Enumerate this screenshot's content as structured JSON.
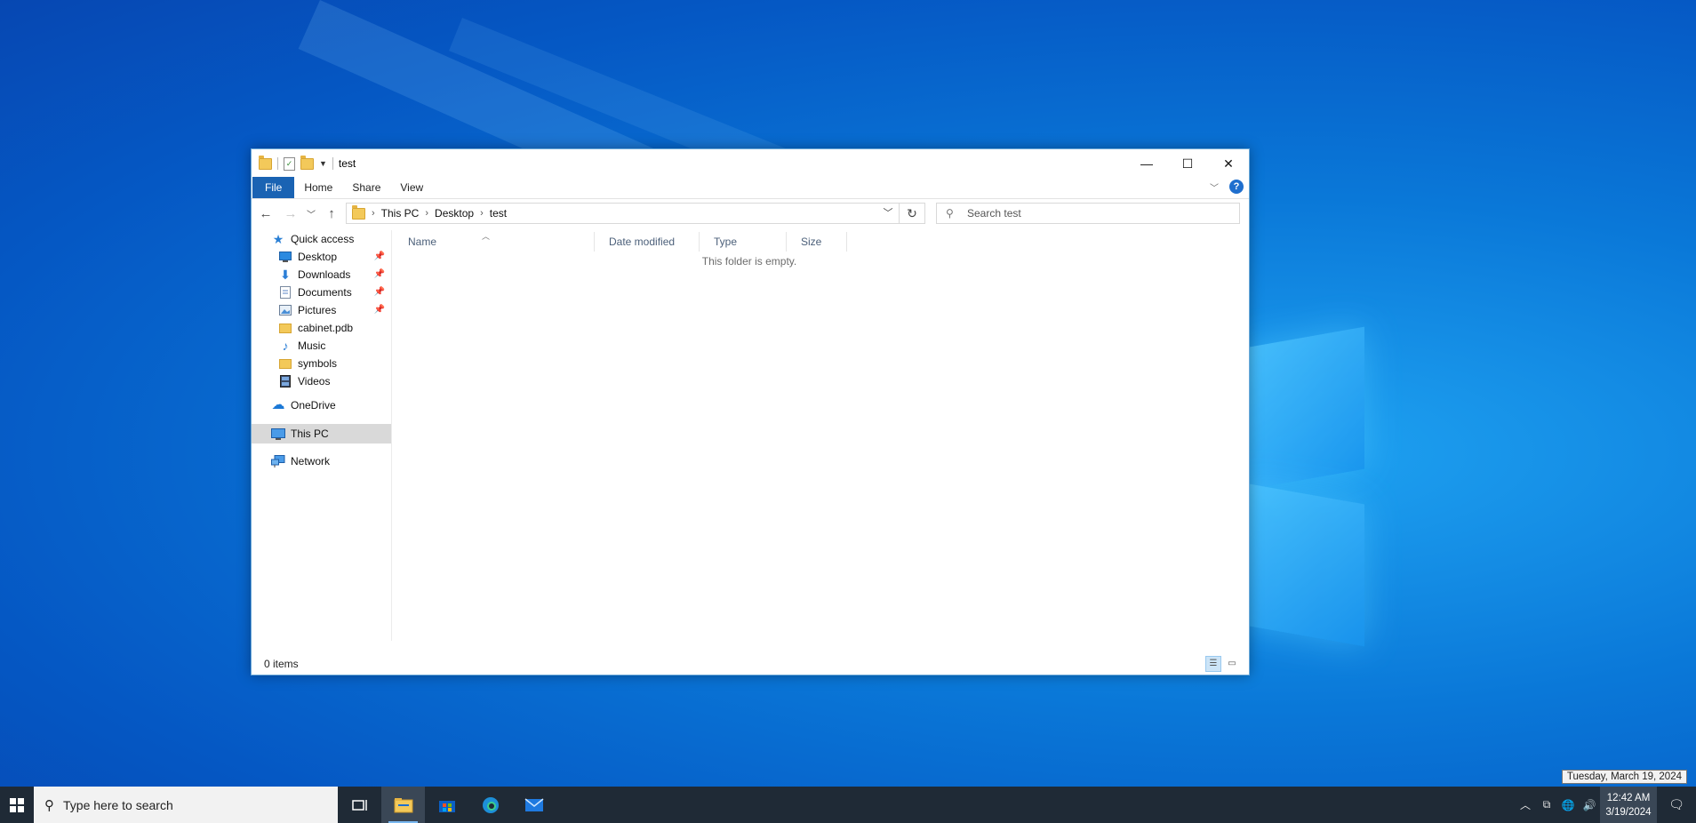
{
  "window": {
    "title": "test",
    "ribbon_tabs": [
      "File",
      "Home",
      "Share",
      "View"
    ],
    "help_label": "?",
    "controls": {
      "minimize": "—",
      "maximize": "☐",
      "close": "✕"
    }
  },
  "address": {
    "crumbs": [
      "This PC",
      "Desktop",
      "test"
    ]
  },
  "search": {
    "placeholder": "Search test"
  },
  "navpane": {
    "quick_access": "Quick access",
    "items": [
      {
        "label": "Desktop",
        "icon": "desktop-icon",
        "pinned": true
      },
      {
        "label": "Downloads",
        "icon": "downloads-icon",
        "pinned": true
      },
      {
        "label": "Documents",
        "icon": "documents-icon",
        "pinned": true
      },
      {
        "label": "Pictures",
        "icon": "pictures-icon",
        "pinned": true
      },
      {
        "label": "cabinet.pdb",
        "icon": "folder-icon",
        "pinned": false
      },
      {
        "label": "Music",
        "icon": "music-icon",
        "pinned": false
      },
      {
        "label": "symbols",
        "icon": "folder-icon",
        "pinned": false
      },
      {
        "label": "Videos",
        "icon": "videos-icon",
        "pinned": false
      }
    ],
    "onedrive": "OneDrive",
    "this_pc": "This PC",
    "network": "Network"
  },
  "columns": [
    "Name",
    "Date modified",
    "Type",
    "Size"
  ],
  "empty_message": "This folder is empty.",
  "status": {
    "items": "0 items"
  },
  "taskbar": {
    "search_placeholder": "Type here to search",
    "time": "12:42 AM",
    "date": "3/19/2024",
    "tooltip": "Tuesday, March 19, 2024"
  },
  "colors": {
    "accent": "#1a63b3",
    "taskbar": "#1f2a36",
    "desktop": "#0a78d8"
  }
}
